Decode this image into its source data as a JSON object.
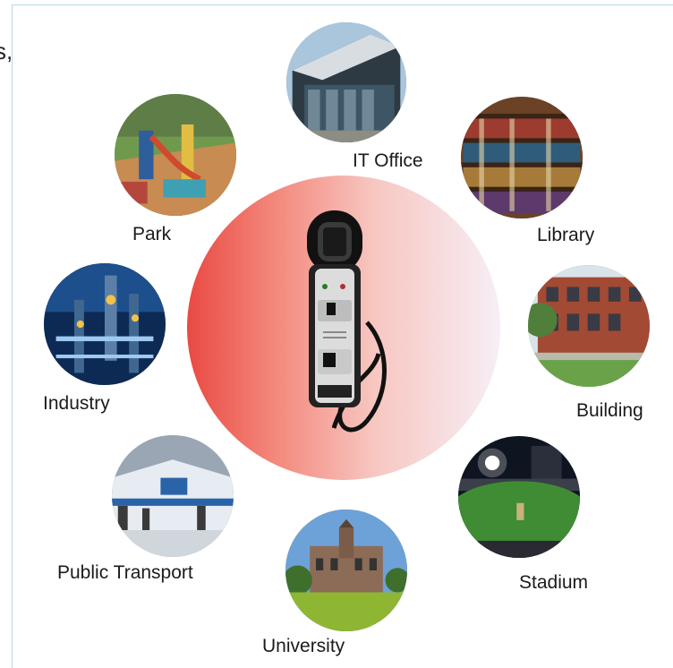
{
  "cut_text": "s,",
  "locations": [
    {
      "id": "it-office",
      "label": "IT Office"
    },
    {
      "id": "park",
      "label": "Park"
    },
    {
      "id": "library",
      "label": "Library"
    },
    {
      "id": "industry",
      "label": "Industry"
    },
    {
      "id": "building",
      "label": "Building"
    },
    {
      "id": "public-transport",
      "label": "Public Transport"
    },
    {
      "id": "stadium",
      "label": "Stadium"
    },
    {
      "id": "university",
      "label": "University"
    }
  ]
}
